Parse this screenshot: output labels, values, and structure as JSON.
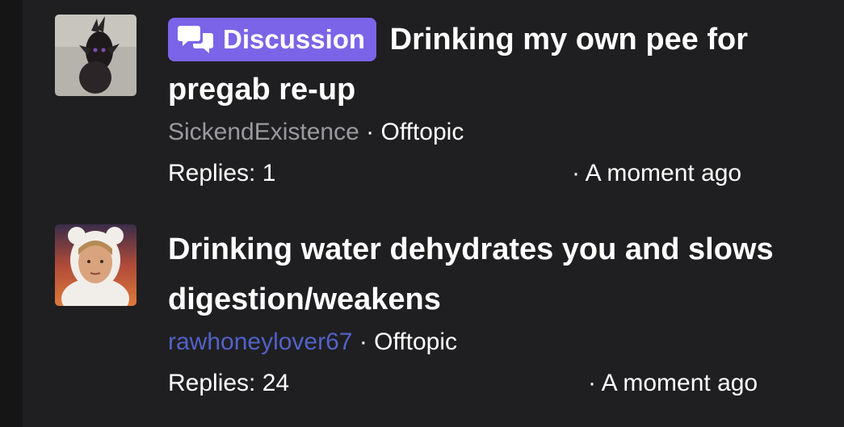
{
  "threads": [
    {
      "prefix_badge": "Discussion",
      "title": "Drinking my own pee for pregab re-up",
      "author": "SickendExistence",
      "separator": "·",
      "forum": "Offtopic",
      "replies": "Replies: 1",
      "time": "· A moment ago",
      "colors": {
        "author": "#9a9a9e",
        "badge": "#7b64e8"
      }
    },
    {
      "title": "Drinking water dehydrates you and slows digestion/weakens",
      "author": "rawhoneylover67",
      "separator": "·",
      "forum": "Offtopic",
      "replies": "Replies: 24",
      "time": "· A moment ago",
      "colors": {
        "author": "#5262c7"
      }
    }
  ],
  "icons": [
    "discussion-chat-icon"
  ]
}
